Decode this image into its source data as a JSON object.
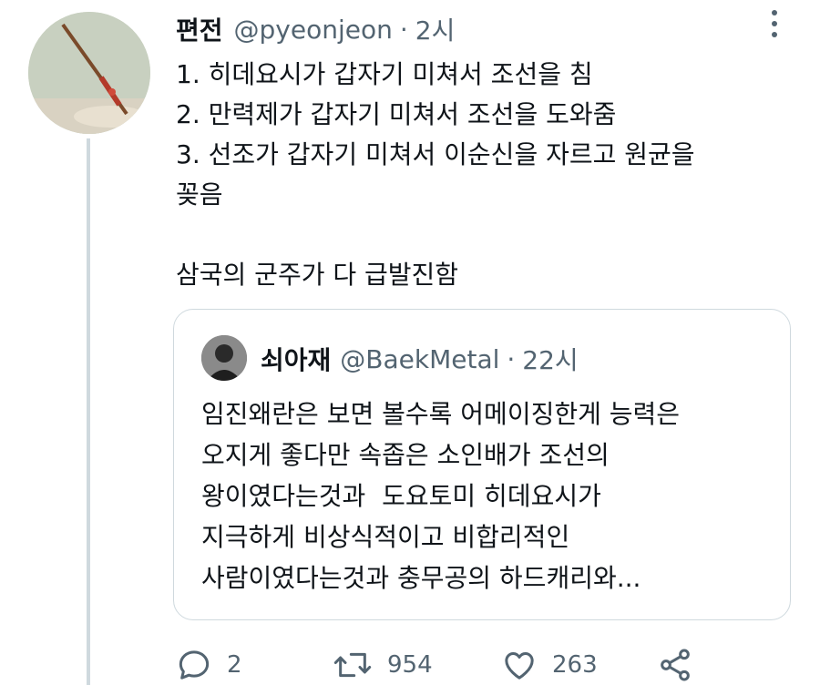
{
  "tweet": {
    "display_name": "편전",
    "handle": "@pyeonjeon",
    "separator": "·",
    "time": "2시",
    "text": "1. 히데요시가 갑자기 미쳐서 조선을 침\n2. 만력제가 갑자기 미쳐서 조선을 도와줌\n3. 선조가 갑자기 미쳐서 이순신을 자르고 원균을\n꽂음\n\n삼국의 군주가 다 급발진함"
  },
  "quoted_tweet": {
    "display_name": "쇠아재",
    "handle": "@BaekMetal",
    "separator": "·",
    "time": "22시",
    "text": "임진왜란은 보면 볼수록 어메이징한게 능력은\n오지게 좋다만 속좁은 소인배가 조선의\n왕이였다는것과  도요토미 히데요시가\n지극하게 비상식적이고 비합리적인\n사람이였다는것과 충무공의 하드캐리와..."
  },
  "actions": {
    "replies": "2",
    "retweets": "954",
    "likes": "263"
  },
  "icons": {
    "more": "more-vertical-icon",
    "reply": "reply-icon",
    "retweet": "retweet-icon",
    "like": "heart-icon",
    "share": "share-icon"
  },
  "colors": {
    "text": "#0f1419",
    "secondary": "#536471",
    "border": "#cfd9de"
  }
}
